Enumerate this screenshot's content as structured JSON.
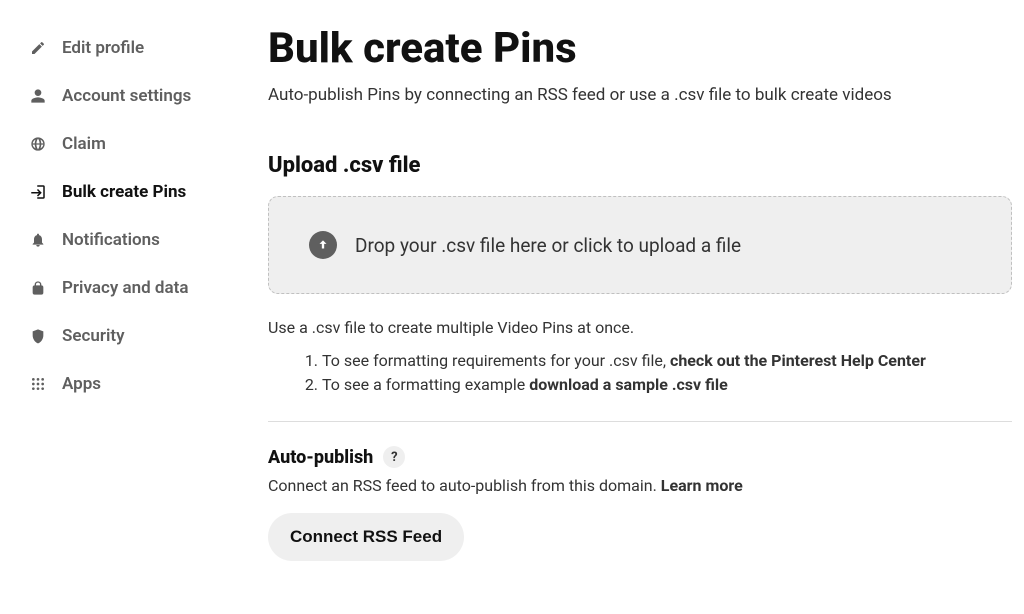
{
  "sidebar": {
    "items": [
      {
        "label": "Edit profile"
      },
      {
        "label": "Account settings"
      },
      {
        "label": "Claim"
      },
      {
        "label": "Bulk create Pins"
      },
      {
        "label": "Notifications"
      },
      {
        "label": "Privacy and data"
      },
      {
        "label": "Security"
      },
      {
        "label": "Apps"
      }
    ]
  },
  "main": {
    "title": "Bulk create Pins",
    "subtitle": "Auto-publish Pins by connecting an RSS feed or use a .csv file to bulk create videos",
    "upload_section": {
      "heading": "Upload .csv file",
      "dropzone_text": "Drop your .csv file here or click to upload a file",
      "help_text": "Use a .csv file to create multiple Video Pins at once.",
      "step1_prefix": "To see formatting requirements for your .csv file, ",
      "step1_link": "check out the Pinterest Help Center",
      "step2_prefix": "To see a formatting example ",
      "step2_link": "download a sample .csv file"
    },
    "auto_publish": {
      "heading": "Auto-publish",
      "help_symbol": "?",
      "desc_prefix": "Connect an RSS feed to auto-publish from this domain. ",
      "learn_more": "Learn more",
      "connect_button": "Connect RSS Feed"
    }
  }
}
